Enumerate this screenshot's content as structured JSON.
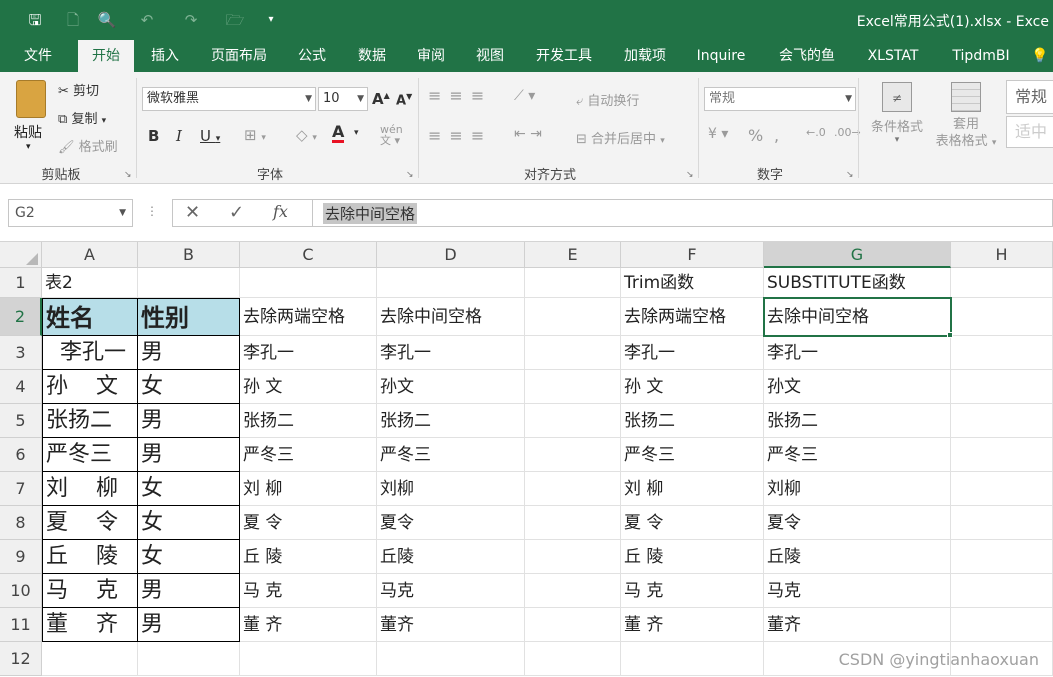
{
  "title": "Excel常用公式(1).xlsx - Exce",
  "tabs": [
    "文件",
    "开始",
    "插入",
    "页面布局",
    "公式",
    "数据",
    "审阅",
    "视图",
    "开发工具",
    "加载项",
    "Inquire",
    "会飞的鱼",
    "XLSTAT",
    "TipdmBI"
  ],
  "ribbon": {
    "clipboard": {
      "paste": "粘贴",
      "cut": "剪切",
      "copy": "复制",
      "format_painter": "格式刷",
      "label": "剪贴板"
    },
    "font": {
      "name": "微软雅黑",
      "size": "10",
      "label": "字体"
    },
    "alignment": {
      "wrap": "自动换行",
      "merge": "合并后居中",
      "label": "对齐方式"
    },
    "number": {
      "format": "常规",
      "label": "数字"
    },
    "styles": {
      "conditional": "条件格式",
      "table_format_1": "套用",
      "table_format_2": "表格格式",
      "style_1": "常规",
      "style_2": "适中"
    }
  },
  "formula_bar": {
    "name_box": "G2",
    "content": "去除中间空格"
  },
  "columns": [
    "A",
    "B",
    "C",
    "D",
    "E",
    "F",
    "G",
    "H"
  ],
  "rows": [
    "1",
    "2",
    "3",
    "4",
    "5",
    "6",
    "7",
    "8",
    "9",
    "10",
    "11",
    "12"
  ],
  "cells": {
    "A1": "表2",
    "F1": "Trim函数",
    "G1": "SUBSTITUTE函数",
    "A2": "姓名",
    "B2": "性别",
    "C2": "去除两端空格",
    "D2": "去除中间空格",
    "F2": "去除两端空格",
    "G2": "去除中间空格",
    "A": [
      "  李孔一",
      "孙    文",
      "张扬二",
      "严冬三",
      "刘    柳",
      "夏    令",
      "丘    陵",
      "马    克",
      "董    齐"
    ],
    "B": [
      "男",
      "女",
      "男",
      "男",
      "女",
      "女",
      "女",
      "男",
      "男"
    ],
    "C": [
      "李孔一",
      "孙 文",
      "张扬二",
      "严冬三",
      "刘 柳",
      "夏 令",
      "丘 陵",
      "马 克",
      "董 齐"
    ],
    "D": [
      "李孔一",
      "孙文",
      "张扬二",
      "严冬三",
      "刘柳",
      "夏令",
      "丘陵",
      "马克",
      "董齐"
    ],
    "F": [
      "李孔一",
      "孙 文",
      "张扬二",
      "严冬三",
      "刘 柳",
      "夏 令",
      "丘 陵",
      "马 克",
      "董 齐"
    ],
    "G": [
      "李孔一",
      "孙文",
      "张扬二",
      "严冬三",
      "刘柳",
      "夏令",
      "丘陵",
      "马克",
      "董齐"
    ]
  },
  "watermark": "CSDN @yingtianhaoxuan"
}
